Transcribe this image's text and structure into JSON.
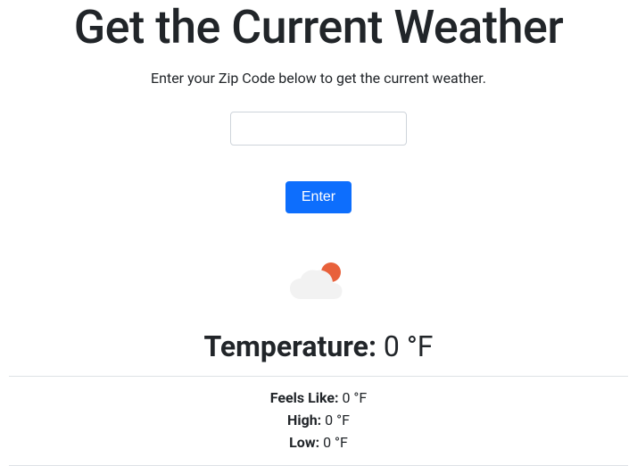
{
  "header": {
    "title": "Get the Current Weather",
    "subtitle": "Enter your Zip Code below to get the current weather."
  },
  "form": {
    "zip_value": "",
    "enter_label": "Enter"
  },
  "weather": {
    "icon": "cloud-sun-icon",
    "temperature_label": "Temperature:",
    "temperature_value": "0 °F",
    "feels_like_label": "Feels Like:",
    "feels_like_value": "0 °F",
    "high_label": "High:",
    "high_value": "0 °F",
    "low_label": "Low:",
    "low_value": "0 °F"
  }
}
